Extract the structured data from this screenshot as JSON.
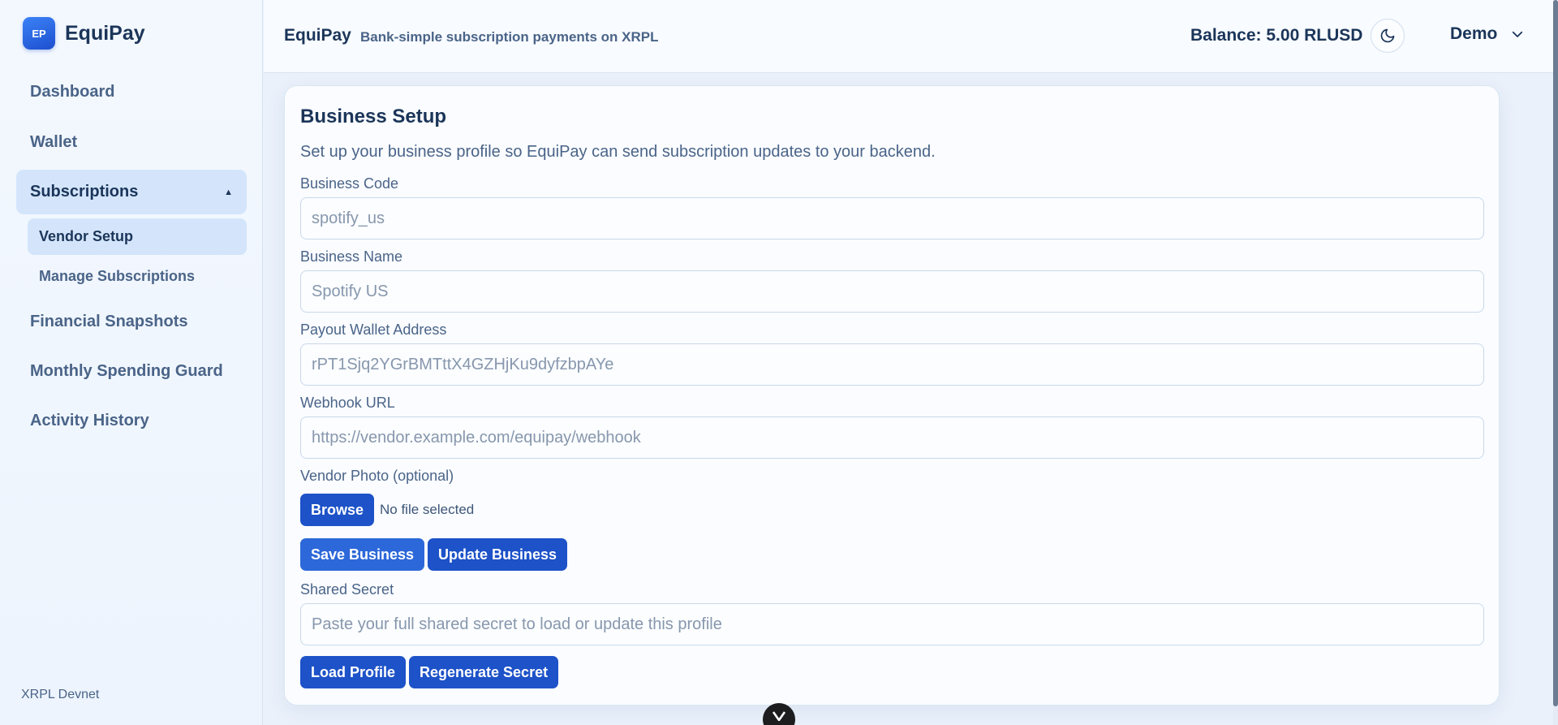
{
  "brand": {
    "logo": "EP",
    "name": "EquiPay"
  },
  "sidebar": {
    "items": [
      {
        "label": "Dashboard"
      },
      {
        "label": "Wallet"
      }
    ],
    "group": {
      "label": "Subscriptions",
      "expanded": true,
      "children": [
        {
          "label": "Vendor Setup",
          "active": true
        },
        {
          "label": "Manage Subscriptions",
          "active": false
        }
      ]
    },
    "items_after": [
      {
        "label": "Financial Snapshots"
      },
      {
        "label": "Monthly Spending Guard"
      },
      {
        "label": "Activity History"
      }
    ],
    "footer": "XRPL Devnet"
  },
  "header": {
    "title": "EquiPay",
    "subtitle": "Bank-simple subscription payments on XRPL",
    "balance": "Balance: 5.00 RLUSD",
    "theme_icon": "moon-icon",
    "user": "Demo"
  },
  "form": {
    "title": "Business Setup",
    "description": "Set up your business profile so EquiPay can send subscription updates to your backend.",
    "business_code": {
      "label": "Business Code",
      "value": "",
      "placeholder": "spotify_us"
    },
    "business_name": {
      "label": "Business Name",
      "value": "",
      "placeholder": "Spotify US"
    },
    "payout_wallet": {
      "label": "Payout Wallet Address",
      "value": "",
      "placeholder": "rPT1Sjq2YGrBMTttX4GZHjKu9dyfzbpAYe"
    },
    "webhook_url": {
      "label": "Webhook URL",
      "value": "",
      "placeholder": "https://vendor.example.com/equipay/webhook"
    },
    "vendor_photo": {
      "label": "Vendor Photo (optional)",
      "browse_label": "Browse",
      "status": "No file selected"
    },
    "save_label": "Save Business",
    "update_label": "Update Business",
    "shared_secret": {
      "label": "Shared Secret",
      "value": "",
      "placeholder": "Paste your full shared secret to load or update this profile"
    },
    "load_label": "Load Profile",
    "regenerate_label": "Regenerate Secret"
  },
  "colors": {
    "accent": "#2c68d9",
    "accent_dark": "#1d52c8",
    "active_bg": "#d4e5fb",
    "text_primary": "#1b3559",
    "text_secondary": "#4a6488"
  }
}
